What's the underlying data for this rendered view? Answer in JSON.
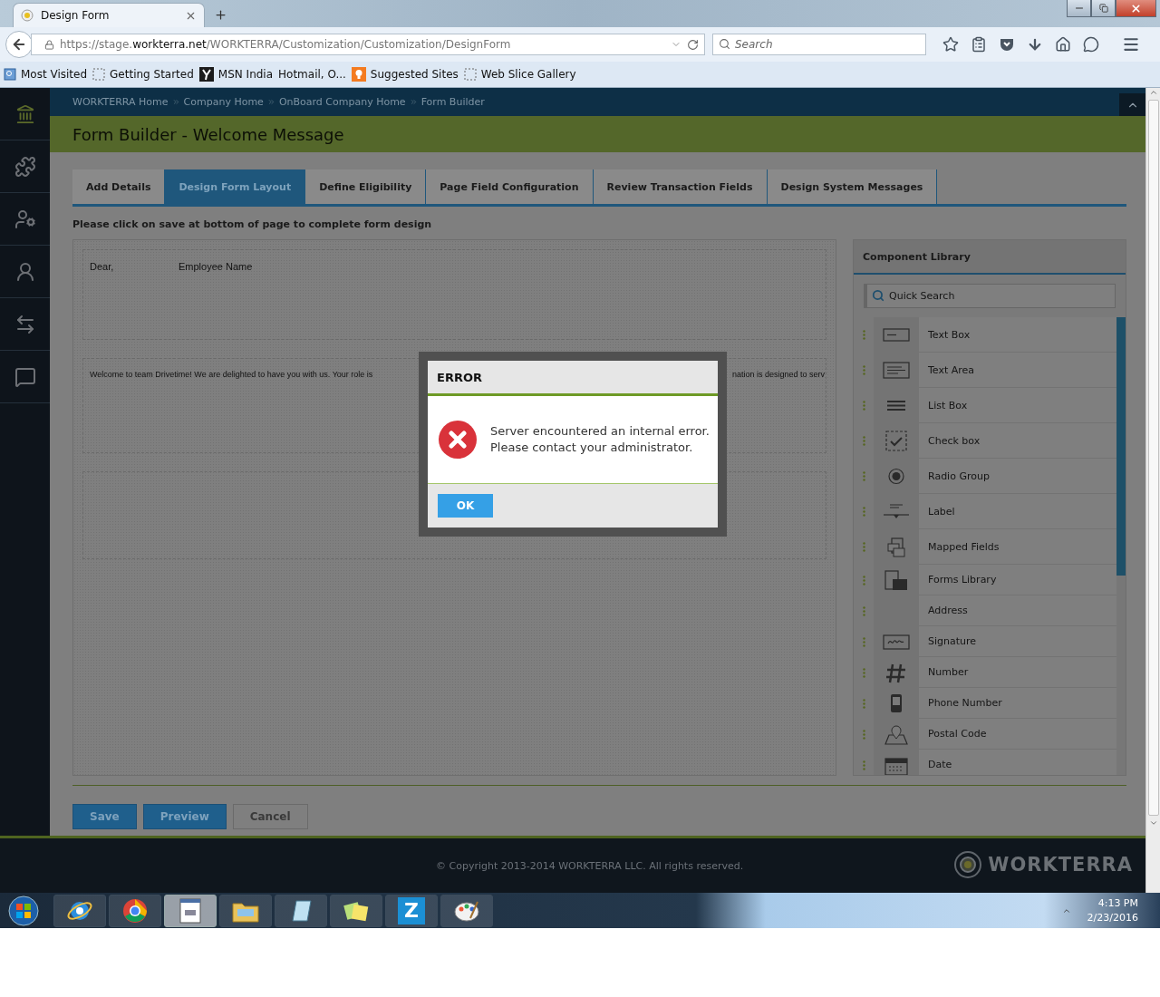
{
  "browser": {
    "tab_title": "Design Form",
    "url": {
      "prefix": "https://stage.",
      "host": "workterra.net",
      "path": "/WORKTERRA/Customization/Customization/DesignForm"
    },
    "search": {
      "placeholder": "Search"
    },
    "bookmarks": [
      {
        "label": "Most Visited",
        "kind": "page"
      },
      {
        "label": "Getting Started",
        "kind": "dashed"
      },
      {
        "label": "MSN India",
        "kind": "dark"
      },
      {
        "label": "Hotmail, O...",
        "kind": "none"
      },
      {
        "label": "Suggested Sites",
        "kind": "orange"
      },
      {
        "label": "Web Slice Gallery",
        "kind": "dashed"
      }
    ]
  },
  "breadcrumb": [
    "WORKTERRA Home",
    "Company Home",
    "OnBoard Company Home",
    "Form Builder"
  ],
  "page_title": "Form Builder - Welcome Message",
  "tabs": [
    {
      "label": "Add Details",
      "selected": false
    },
    {
      "label": "Design Form Layout",
      "selected": true
    },
    {
      "label": "Define Eligibility",
      "selected": false
    },
    {
      "label": "Page Field Configuration",
      "selected": false
    },
    {
      "label": "Review Transaction Fields",
      "selected": false
    },
    {
      "label": "Design System Messages",
      "selected": false
    }
  ],
  "instruction": "Please click on save at bottom of page to complete form design",
  "form_sections": [
    {
      "kind": "greeting",
      "salutation": "Dear,",
      "field": "Employee Name"
    },
    {
      "kind": "paragraph",
      "text_left": "Welcome to team Drivetime! We are delighted to have you with us. Your role is",
      "text_right": "nation is designed to serv"
    },
    {
      "kind": "blank"
    }
  ],
  "component_library": {
    "title": "Component Library",
    "search": {
      "placeholder": "Quick Search"
    },
    "items": [
      {
        "label": "Text Box"
      },
      {
        "label": "Text Area"
      },
      {
        "label": "List Box"
      },
      {
        "label": "Check box"
      },
      {
        "label": "Radio Group"
      },
      {
        "label": "Label"
      },
      {
        "label": "Mapped Fields"
      },
      {
        "label": "Forms Library"
      },
      {
        "label": "Address"
      },
      {
        "label": "Signature"
      },
      {
        "label": "Number"
      },
      {
        "label": "Phone Number"
      },
      {
        "label": "Postal Code"
      },
      {
        "label": "Date"
      }
    ]
  },
  "buttons": [
    {
      "label": "Save",
      "kind": "primary"
    },
    {
      "label": "Preview",
      "kind": "primary"
    },
    {
      "label": "Cancel",
      "kind": "secondary"
    }
  ],
  "footer": {
    "copyright": "© Copyright 2013-2014 WORKTERRA LLC. All rights reserved.",
    "logo": "WORKTERRA"
  },
  "dialog": {
    "title": "ERROR",
    "message": [
      "Server encountered an internal error.",
      "Please contact your administrator."
    ],
    "button": "OK"
  },
  "taskbar": {
    "apps": [
      {
        "kind": "ring",
        "selected": false
      },
      {
        "kind": "tricolor",
        "selected": false
      },
      {
        "kind": "document",
        "selected": true
      },
      {
        "kind": "folder",
        "selected": false
      },
      {
        "kind": "notebook",
        "selected": false
      },
      {
        "kind": "notes",
        "selected": false
      },
      {
        "kind": "letter",
        "label": "Z",
        "selected": false
      },
      {
        "kind": "palette",
        "selected": false
      }
    ],
    "time": "4:13 PM",
    "date": "2/23/2016"
  }
}
